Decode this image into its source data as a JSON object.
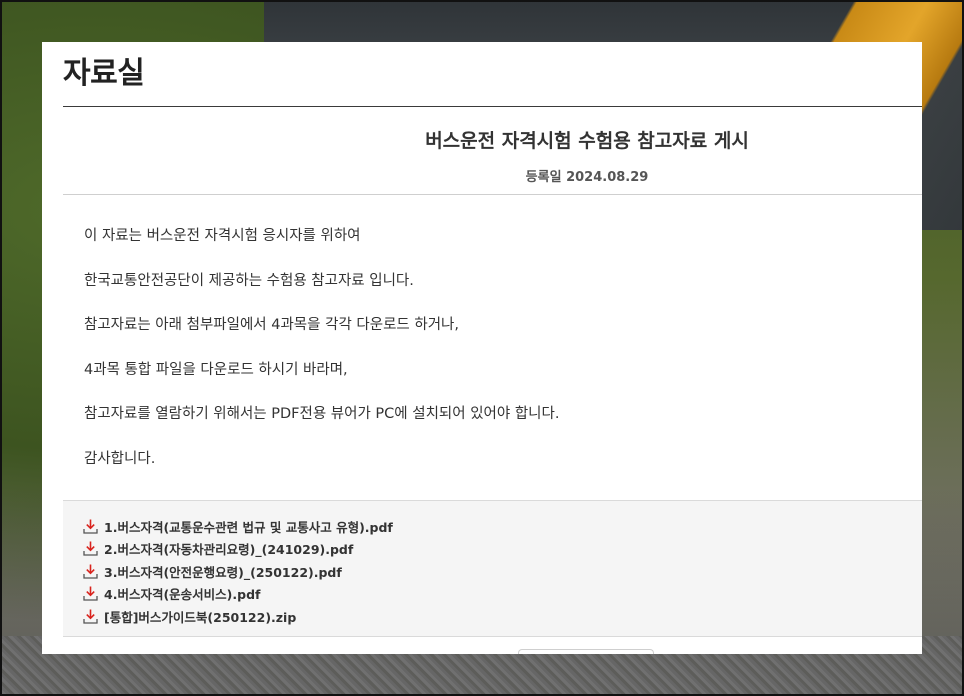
{
  "page": {
    "title": "자료실"
  },
  "post": {
    "title": "버스운전 자격시험 수험용 참고자료 게시",
    "date_label": "등록일 2024.08.29",
    "paragraphs": [
      "이 자료는 버스운전 자격시험 응시자를 위하여",
      "한국교통안전공단이 제공하는 수험용 참고자료 입니다.",
      "참고자료는 아래 첨부파일에서 4과목을 각각 다운로드 하거나,",
      "4과목 통합 파일을 다운로드 하시기 바라며,",
      "참고자료를 열람하기 위해서는 PDF전용 뷰어가 PC에 설치되어 있어야 합니다.",
      "감사합니다."
    ]
  },
  "attachments": [
    {
      "name": "1.버스자격(교통운수관련 법규 및 교통사고 유형).pdf",
      "icon": "download-icon"
    },
    {
      "name": "2.버스자격(자동차관리요령)_(241029).pdf",
      "icon": "download-icon"
    },
    {
      "name": "3.버스자격(안전운행요령)_(250122).pdf",
      "icon": "download-icon"
    },
    {
      "name": "4.버스자격(운송서비스).pdf",
      "icon": "download-icon"
    },
    {
      "name": "[통합]버스가이드북(250122).zip",
      "icon": "download-icon"
    }
  ],
  "colors": {
    "download_arrow": "#d9231d",
    "download_tray": "#555555",
    "title_text": "#222222"
  }
}
